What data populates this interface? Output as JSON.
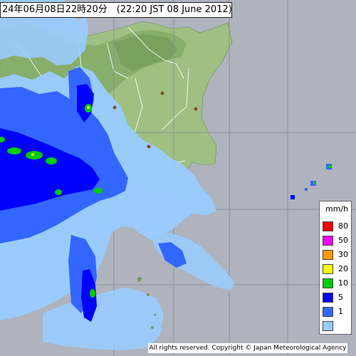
{
  "map": {
    "timestamp_label": "24年06月08日22時20分　(22:20 JST 08 June 2012)",
    "copyright": "All rights reserved. Copyright © Japan Meteorological Agency",
    "colors": {
      "sea": "#aeb3bd",
      "land": "#9fc082",
      "highland": "#7fa663",
      "border": "#ffffff",
      "grid": "#8a8f99"
    }
  },
  "legend": {
    "unit": "mm/h",
    "items": [
      {
        "label": "80",
        "color": "#ff0000"
      },
      {
        "label": "50",
        "color": "#ff00ff"
      },
      {
        "label": "30",
        "color": "#ff9900"
      },
      {
        "label": "20",
        "color": "#ffff00"
      },
      {
        "label": "10",
        "color": "#00cc00"
      },
      {
        "label": "5",
        "color": "#0000ff"
      },
      {
        "label": "1",
        "color": "#3366ff"
      },
      {
        "label": "",
        "color": "#99ccff"
      }
    ]
  }
}
